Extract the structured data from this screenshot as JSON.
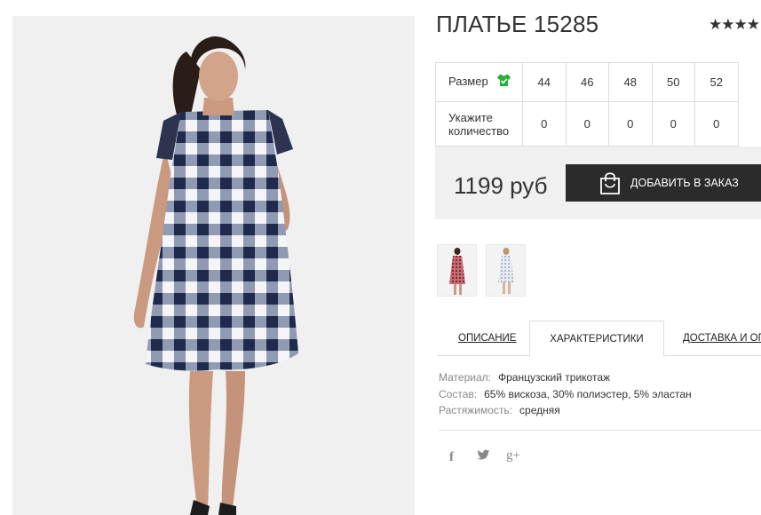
{
  "product": {
    "title": "ПЛАТЬЕ 15285",
    "rating_stars": "★★★★",
    "price": "1199 руб",
    "order_button": "ДОБАВИТЬ В ЗАКАЗ"
  },
  "sizes": {
    "size_label": "Размер",
    "quantity_label": "Укажите количество",
    "values": [
      "44",
      "46",
      "48",
      "50",
      "52"
    ],
    "quantities": [
      "0",
      "0",
      "0",
      "0",
      "0"
    ]
  },
  "tabs": [
    {
      "label": "ОПИСАНИЕ"
    },
    {
      "label": "ХАРАКТЕРИСТИКИ"
    },
    {
      "label": "ДОСТАВКА И ОПЛ"
    }
  ],
  "specs": [
    {
      "key": "Материал:",
      "value": "Французский трикотаж"
    },
    {
      "key": "Состав:",
      "value": "65% вискоза, 30% полиэстер, 5% эластан"
    },
    {
      "key": "Растяжимость:",
      "value": "средняя"
    }
  ],
  "social": {
    "facebook": "f",
    "twitter": "t",
    "google": "g+"
  },
  "icons": {
    "size_chart": "green-tshirt-icon",
    "bag": "shopping-bag-icon"
  },
  "colors": {
    "button_bg": "#2b2b2b",
    "price_box_bg": "#f0f0f0",
    "size_icon_green": "#27ae3c"
  }
}
